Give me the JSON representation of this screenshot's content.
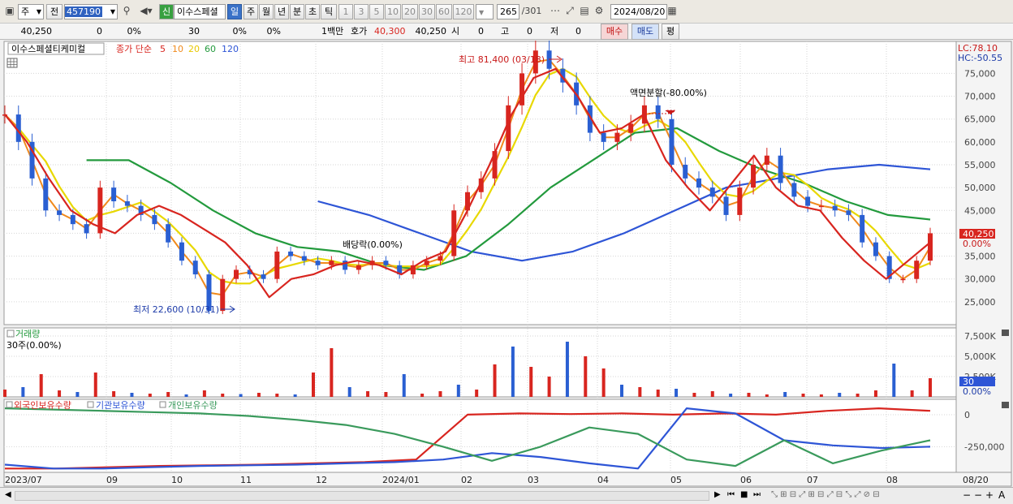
{
  "toolbar": {
    "period_select": "주",
    "prev_label": "전",
    "code": "457190",
    "new_badge": "신",
    "stock_name": "이수스페셜",
    "tf_day": "일",
    "tf_week": "주",
    "tf_month": "월",
    "tf_year": "년",
    "tf_min": "분",
    "tf_sec": "초",
    "tf_tick": "틱",
    "n1": "1",
    "n3": "3",
    "n5": "5",
    "n10": "10",
    "n20": "20",
    "n30": "30",
    "n60": "60",
    "n120": "120",
    "count": "265",
    "total": "/301",
    "date": "2024/08/20"
  },
  "quote": {
    "price": "40,250",
    "change": "0",
    "change_pct": "0%",
    "vol": "30",
    "vol_pct": "0%",
    "vol_pct2": "0%",
    "unit": "1백만",
    "hoga_label": "호가",
    "hoga": "40,300",
    "cur": "40,250",
    "open_label": "시",
    "open": "0",
    "high_label": "고",
    "high": "0",
    "low_label": "저",
    "low": "0",
    "buy": "매수",
    "sell": "매도",
    "avg": "평"
  },
  "legend": {
    "name": "이수스페셜티케미컬",
    "ma_title": "종가 단순",
    "ma": [
      {
        "label": "5",
        "color": "#d8251f"
      },
      {
        "label": "10",
        "color": "#f08a1c"
      },
      {
        "label": "20",
        "color": "#e8d800"
      },
      {
        "label": "60",
        "color": "#239a3d"
      },
      {
        "label": "120",
        "color": "#2e55d6"
      }
    ]
  },
  "annotations": {
    "high": "최고 81,400 (03/18)",
    "low": "최저 22,600 (10/31)",
    "split": "액면분할(-80.00%)",
    "dividend": "배당락(0.00%)"
  },
  "right_labels": {
    "lc": "LC:78.10",
    "hc": "HC:-50.55",
    "price_tag": "40,250",
    "price_pct": "0.00%",
    "vol_tag": "30",
    "vol_pct": "0.00%"
  },
  "volume_panel": {
    "title": "거래량",
    "sub": "30주(0.00%)"
  },
  "holder_panel": {
    "s1": "외국인보유수량",
    "s2": "기관보유수량",
    "s3": "개인보유수량"
  },
  "colors": {
    "up": "#d8251f",
    "down": "#2a5fd2",
    "ma5": "#d8251f",
    "ma10": "#f08a1c",
    "ma20": "#e8d800",
    "ma60": "#239a3d",
    "ma120": "#2e55d6",
    "foreign": "#d8251f",
    "inst": "#2e55d6",
    "indiv": "#3a9a5c"
  },
  "chart_data": [
    {
      "type": "candlestick",
      "title": "이수스페셜티케미컬",
      "x_labels": [
        "2023/07",
        "09",
        "10",
        "11",
        "12",
        "2024/01",
        "02",
        "03",
        "04",
        "05",
        "06",
        "07",
        "08",
        "08/20"
      ],
      "yticks": [
        25000,
        30000,
        35000,
        40000,
        45000,
        50000,
        55000,
        60000,
        65000,
        70000,
        75000
      ],
      "ylim": [
        20000,
        82000
      ],
      "close": [
        66000,
        60000,
        52000,
        45000,
        44000,
        42000,
        40000,
        50000,
        47000,
        46000,
        44000,
        42000,
        38000,
        34000,
        31000,
        23000,
        30000,
        32000,
        31000,
        30000,
        36000,
        35000,
        34000,
        33000,
        34000,
        32000,
        33000,
        34000,
        33000,
        31000,
        33000,
        34000,
        35000,
        45000,
        49000,
        52000,
        58000,
        68000,
        75000,
        80000,
        76000,
        73000,
        68000,
        62000,
        60000,
        62000,
        64000,
        68000,
        65000,
        55000,
        52000,
        50000,
        48000,
        44000,
        50000,
        55000,
        57000,
        51000,
        48000,
        46000,
        46000,
        45000,
        44000,
        38000,
        35000,
        30000,
        30000,
        34000,
        40000
      ],
      "ma5_approx": [
        66000,
        60000,
        52000,
        45000,
        42000,
        40000,
        44000,
        46000,
        44000,
        41000,
        38000,
        33000,
        26000,
        30000,
        31000,
        33000,
        34000,
        33000,
        31000,
        34000,
        36000,
        45000,
        55000,
        66000,
        74000,
        76000,
        70000,
        62000,
        63000,
        66000,
        56000,
        50000,
        45000,
        51000,
        57000,
        50000,
        46000,
        45000,
        39000,
        34000,
        30000,
        34000,
        38000
      ],
      "ma60_approx": [
        56000,
        56000,
        51000,
        45000,
        40000,
        37000,
        36000,
        33000,
        32000,
        35000,
        42000,
        50000,
        56000,
        62000,
        63000,
        58000,
        54000,
        51000,
        47000,
        44000,
        43000
      ],
      "ma120_approx": [
        47000,
        44000,
        40000,
        36000,
        34000,
        36000,
        40000,
        45000,
        50000,
        52000,
        54000,
        55000,
        54000
      ]
    },
    {
      "type": "bar",
      "title": "거래량",
      "yticks": [
        "7,500K",
        "5,000K",
        "2,500K"
      ],
      "values_k": [
        900,
        1200,
        2800,
        800,
        600,
        3000,
        700,
        500,
        400,
        600,
        300,
        800,
        400,
        350,
        500,
        400,
        300,
        3000,
        6000,
        1200,
        700,
        600,
        2800,
        400,
        700,
        1500,
        900,
        4000,
        6200,
        3700,
        2500,
        6800,
        5000,
        3500,
        1500,
        1200,
        900,
        1000,
        500,
        700,
        400,
        500,
        300,
        600,
        400,
        300,
        500,
        400,
        800,
        4100,
        800,
        2300
      ]
    },
    {
      "type": "line",
      "title": "보유수량",
      "yticks": [
        "0",
        "-250,000"
      ],
      "series": [
        {
          "name": "외국인보유수량",
          "values": [
            -420000,
            -420000,
            -410000,
            -400000,
            -395000,
            -390000,
            -380000,
            -370000,
            -350000,
            0,
            10000,
            5000,
            10000,
            0,
            10000,
            0,
            30000,
            50000,
            30000
          ]
        },
        {
          "name": "기관보유수량",
          "values": [
            -390000,
            -420000,
            -420000,
            -410000,
            -400000,
            -395000,
            -390000,
            -380000,
            -370000,
            -350000,
            -300000,
            -330000,
            -380000,
            -420000,
            50000,
            10000,
            -200000,
            -240000,
            -260000,
            -250000
          ]
        },
        {
          "name": "개인보유수량",
          "values": [
            50000,
            40000,
            30000,
            20000,
            10000,
            -10000,
            -40000,
            -80000,
            -150000,
            -250000,
            -360000,
            -250000,
            -100000,
            -150000,
            -350000,
            -400000,
            -200000,
            -380000,
            -280000,
            -200000
          ]
        }
      ]
    }
  ]
}
